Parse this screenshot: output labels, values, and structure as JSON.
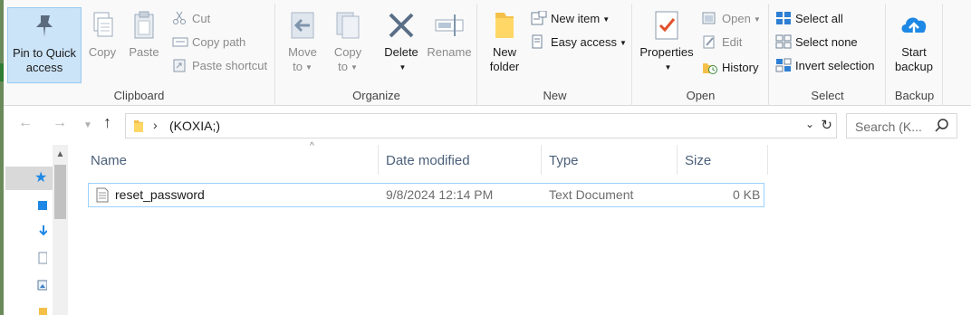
{
  "ribbon": {
    "clipboard": {
      "label": "Clipboard",
      "pin": "Pin to Quick access",
      "pin_line1": "Pin to Quick",
      "pin_line2": "access",
      "copy": "Copy",
      "paste": "Paste",
      "cut": "Cut",
      "copy_path": "Copy path",
      "paste_shortcut": "Paste shortcut"
    },
    "organize": {
      "label": "Organize",
      "move_to_line1": "Move",
      "move_to_line2": "to",
      "copy_to_line1": "Copy",
      "copy_to_line2": "to",
      "delete": "Delete",
      "rename": "Rename"
    },
    "new": {
      "label": "New",
      "new_folder_line1": "New",
      "new_folder_line2": "folder",
      "new_item": "New item",
      "easy_access": "Easy access"
    },
    "open": {
      "label": "Open",
      "properties": "Properties",
      "open": "Open",
      "edit": "Edit",
      "history": "History"
    },
    "select": {
      "label": "Select",
      "select_all": "Select all",
      "select_none": "Select none",
      "invert_selection": "Invert selection"
    },
    "backup": {
      "label": "Backup",
      "start_backup_line1": "Start",
      "start_backup_line2": "backup"
    }
  },
  "address": {
    "path": "(KOXIA;)",
    "search_placeholder": "Search (K..."
  },
  "columns": {
    "name": "Name",
    "date_modified": "Date modified",
    "type": "Type",
    "size": "Size"
  },
  "files": [
    {
      "name": "reset_password",
      "date_modified": "9/8/2024 12:14 PM",
      "type": "Text Document",
      "size": "0 KB"
    }
  ],
  "colors": {
    "accent": "#1e88e5",
    "selection_border": "#99d1ff",
    "selected_button": "#cce4f7",
    "delete_icon": "#5a6f87"
  }
}
